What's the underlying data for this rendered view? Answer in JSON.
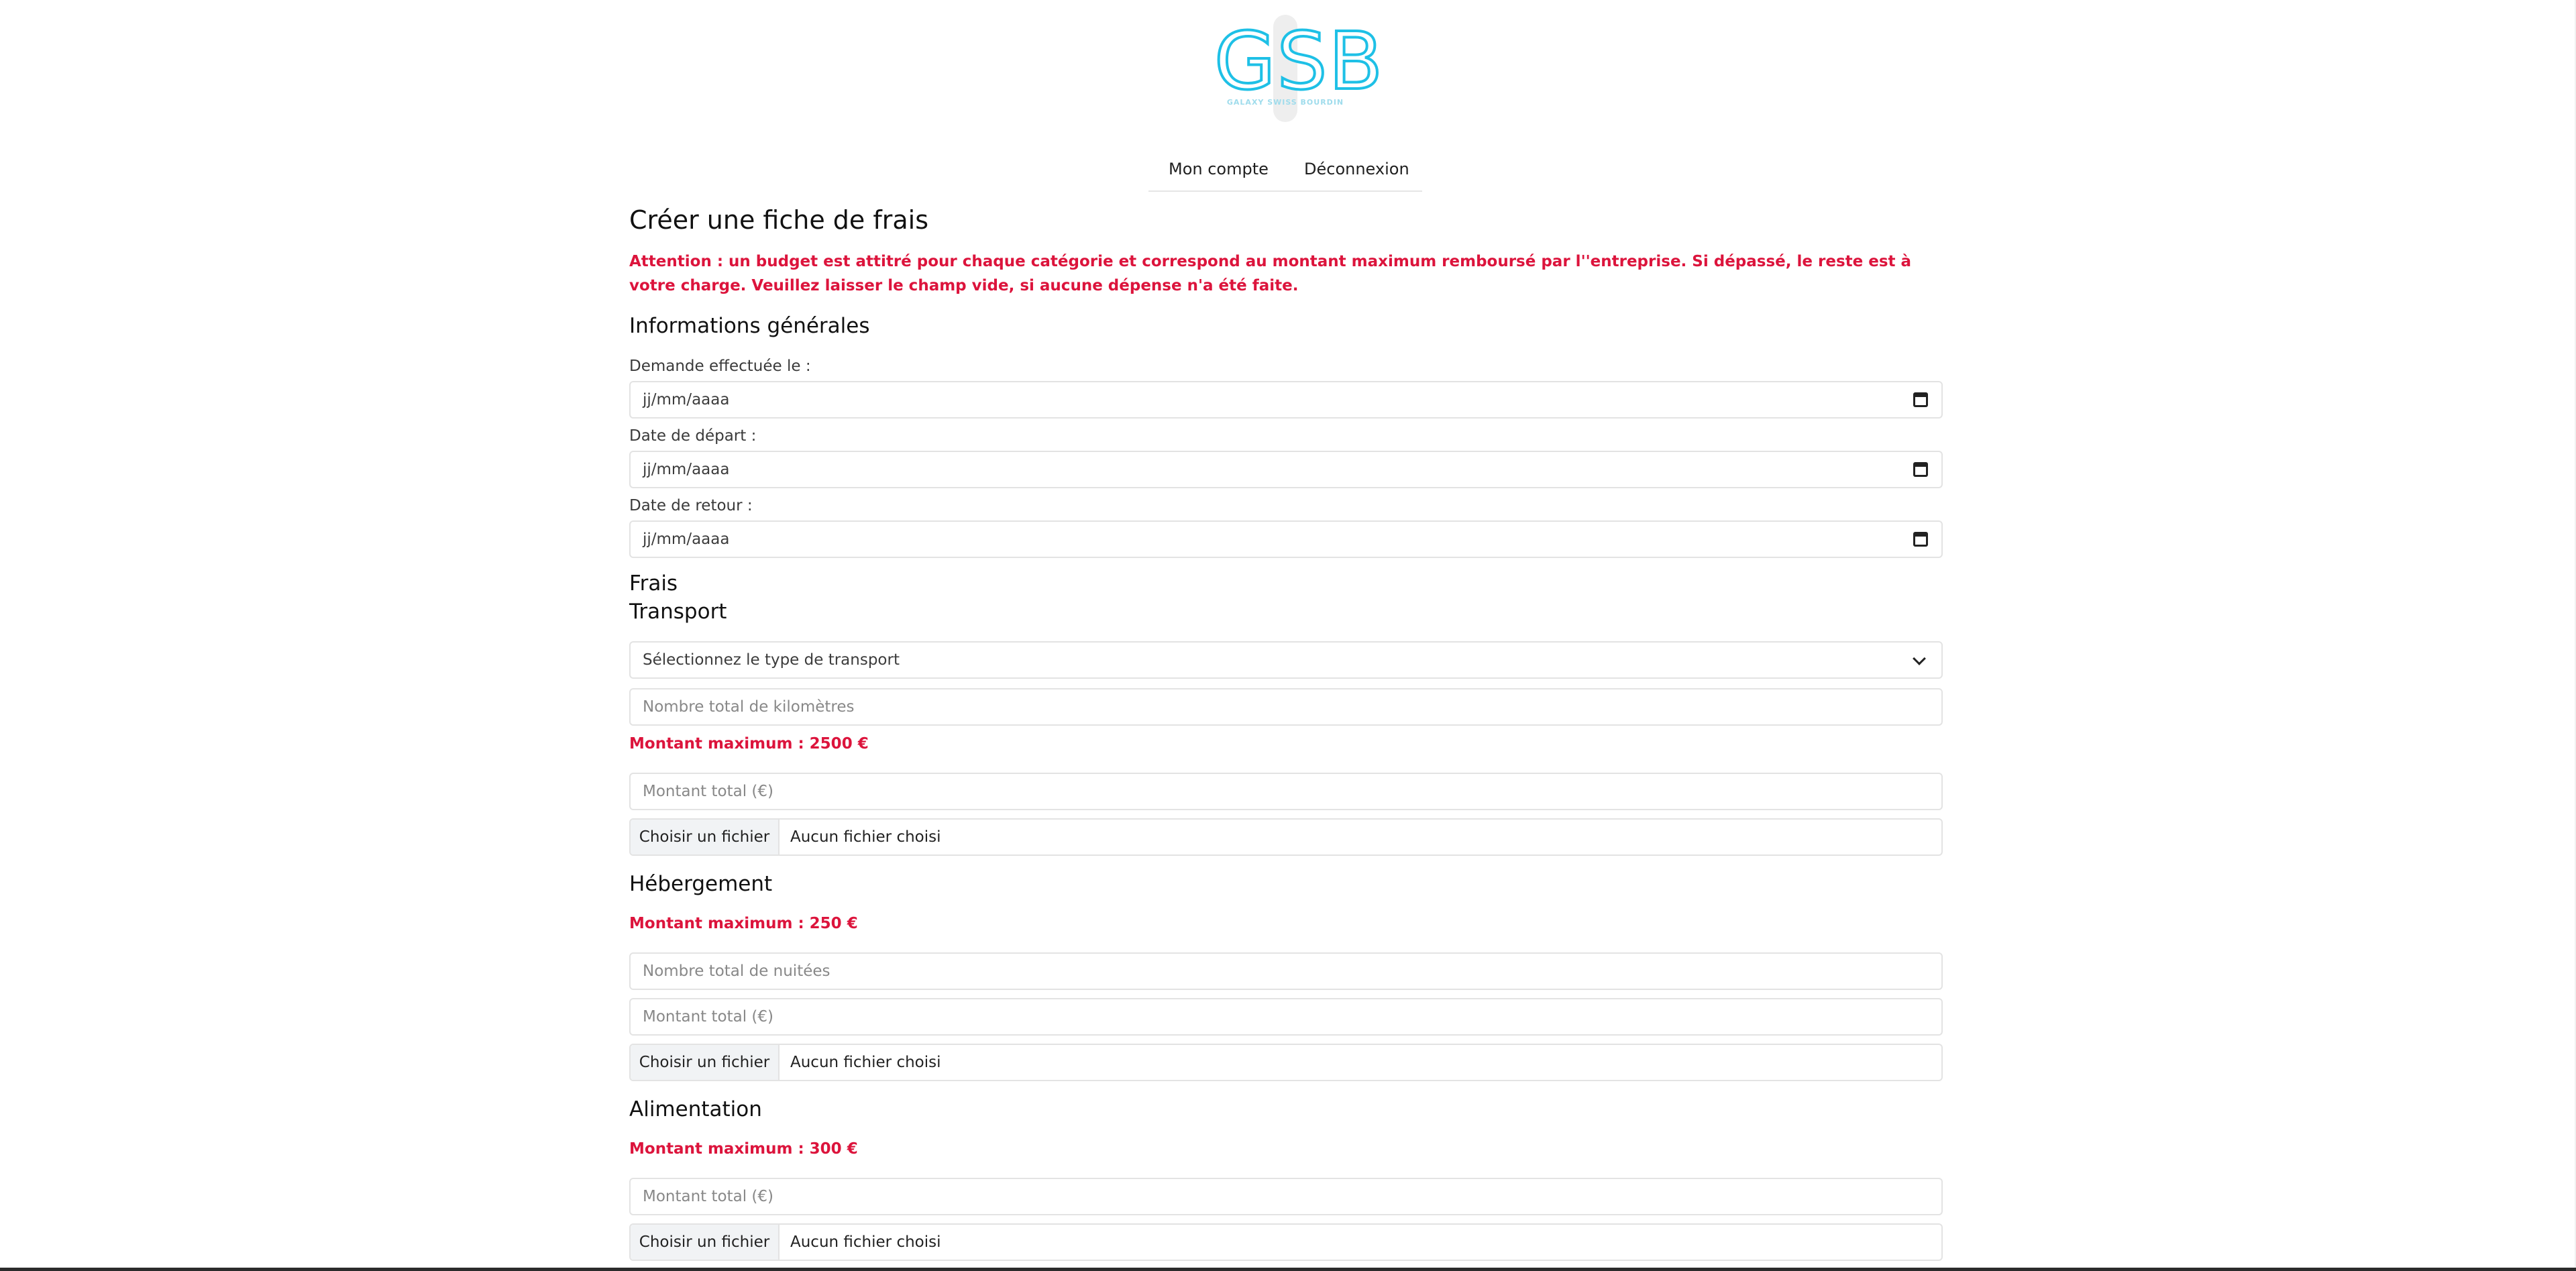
{
  "header": {
    "logo_text": "GSB",
    "logo_subtitle": "GALAXY SWISS BOURDIN",
    "nav": {
      "account": "Mon compte",
      "logout": "Déconnexion"
    }
  },
  "form": {
    "title": "Créer une fiche de frais",
    "warning": "Attention : un budget est attitré pour chaque catégorie et correspond au montant maximum remboursé par l''entreprise. Si dépassé, le reste est à votre charge. Veuillez laisser le champ vide, si aucune dépense n'a été faite.",
    "general": {
      "heading": "Informations générales",
      "request_label": "Demande effectuée le :",
      "request_value": "jj/mm/aaaa",
      "departure_label": "Date de départ :",
      "departure_value": "jj/mm/aaaa",
      "return_label": "Date de retour :",
      "return_value": "jj/mm/aaaa"
    },
    "fees_heading": "Frais",
    "transport": {
      "heading": "Transport",
      "select_text": "Sélectionnez le type de transport",
      "km_placeholder": "Nombre total de kilomètres",
      "max_text": "Montant maximum : 2500 €",
      "amount_placeholder": "Montant total (€)",
      "file_button": "Choisir un fichier",
      "file_status": "Aucun fichier choisi"
    },
    "lodging": {
      "heading": "Hébergement",
      "max_text": "Montant maximum : 250 €",
      "nights_placeholder": "Nombre total de nuitées",
      "amount_placeholder": "Montant total (€)",
      "file_button": "Choisir un fichier",
      "file_status": "Aucun fichier choisi"
    },
    "food": {
      "heading": "Alimentation",
      "max_text": "Montant maximum : 300 €",
      "amount_placeholder": "Montant total (€)",
      "file_button": "Choisir un fichier",
      "file_status": "Aucun fichier choisi"
    }
  },
  "colors": {
    "accent_red": "#dc143c",
    "logo_cyan": "#1ec0e6",
    "border": "#e3e3e3"
  }
}
